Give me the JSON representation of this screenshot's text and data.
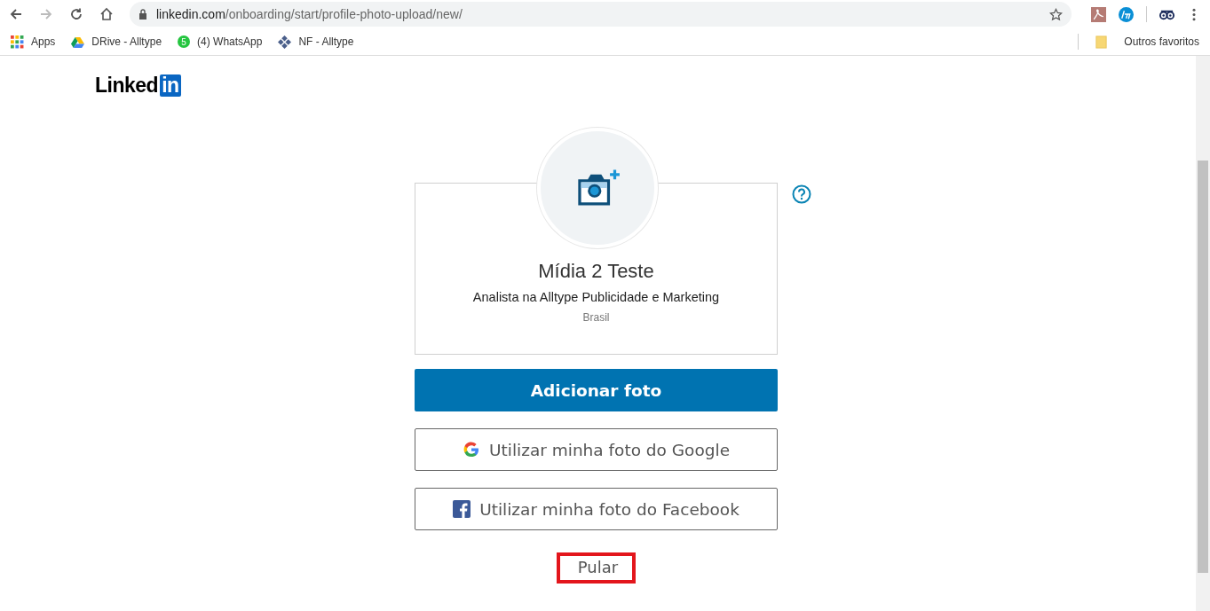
{
  "browser": {
    "url_host": "linkedin.com",
    "url_path": "/onboarding/start/profile-photo-upload/new/",
    "bookmarks": [
      {
        "kind": "apps",
        "label": "Apps"
      },
      {
        "kind": "drive",
        "label": "DRive - Alltype"
      },
      {
        "kind": "whatsapp",
        "label": "(4) WhatsApp",
        "badge": "5"
      },
      {
        "kind": "nf",
        "label": "NF - Alltype"
      }
    ],
    "other_bookmarks": "Outros favoritos"
  },
  "logo": {
    "text": "Linked",
    "badge": "in"
  },
  "profile": {
    "name": "Mídia 2 Teste",
    "headline": "Analista na Alltype Publicidade e Marketing",
    "location": "Brasil"
  },
  "actions": [
    {
      "kind": "primary",
      "label": "Adicionar foto"
    },
    {
      "kind": "google",
      "label": "Utilizar minha foto do Google"
    },
    {
      "kind": "facebook",
      "label": "Utilizar minha foto do Facebook"
    }
  ],
  "skip": {
    "label": "Pular",
    "highlighted": true
  }
}
